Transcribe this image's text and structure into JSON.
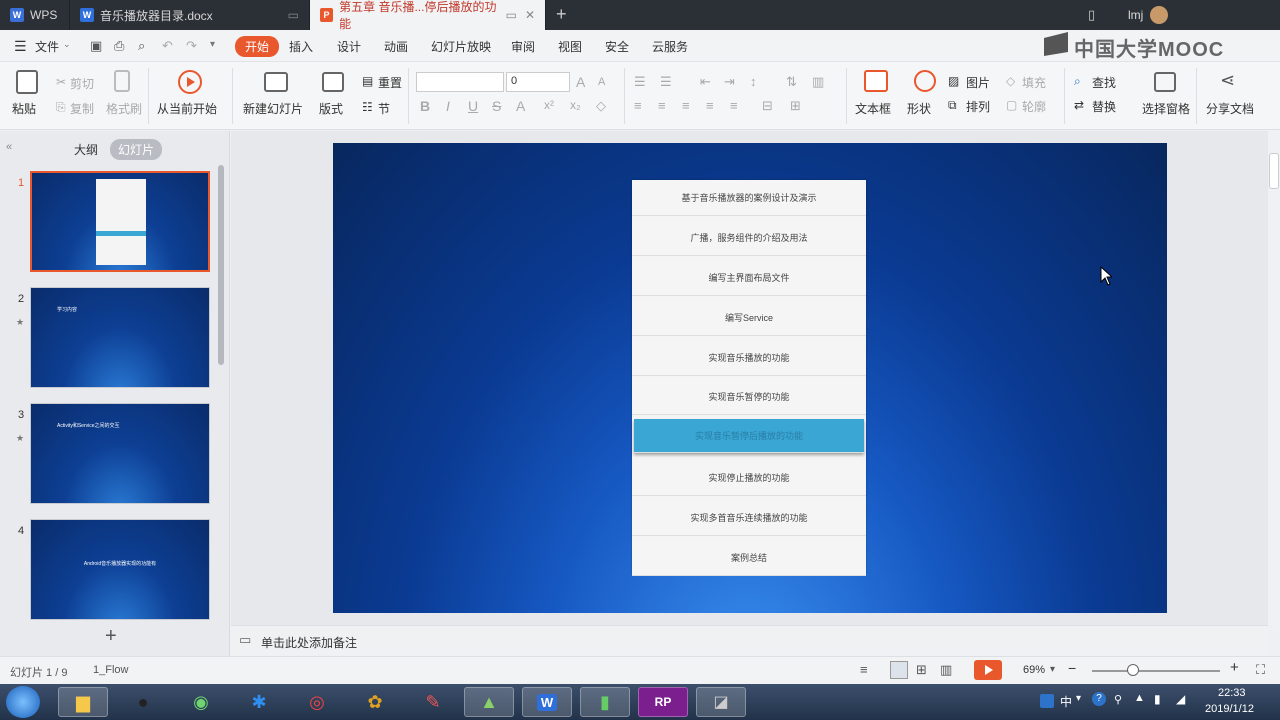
{
  "tabs": [
    {
      "label": "WPS",
      "type": "wps"
    },
    {
      "label": "音乐播放器目录.docx",
      "type": "doc"
    },
    {
      "label": "第五章 音乐播...停后播放的功能",
      "type": "ppt"
    }
  ],
  "user": "lmj",
  "watermark": "中国大学MOOC",
  "menus": [
    "文件",
    "开始",
    "插入",
    "设计",
    "动画",
    "幻灯片放映",
    "审阅",
    "视图",
    "安全",
    "云服务"
  ],
  "ribbon": {
    "paste": "粘贴",
    "cut": "剪切",
    "copy": "复制",
    "format_painter": "格式刷",
    "from_current": "从当前开始",
    "new_slide": "新建幻灯片",
    "layout": "版式",
    "reset": "重置",
    "section": "节",
    "font_size": "0",
    "textbox": "文本框",
    "shape": "形状",
    "picture": "图片",
    "fill": "填充",
    "arrange": "排列",
    "outline": "轮廓",
    "find": "查找",
    "replace": "替换",
    "select_pane": "选择窗格",
    "share": "分享文档"
  },
  "left_panel": {
    "tab_outline": "大纲",
    "tab_slides": "幻灯片",
    "slides": [
      {
        "num": "1",
        "text": ""
      },
      {
        "num": "2",
        "text": "学习内容"
      },
      {
        "num": "3",
        "text": "Activity和Service之间的交互"
      },
      {
        "num": "4",
        "text": "Android音乐播放器实现的功能有"
      }
    ],
    "add": "+"
  },
  "slide_menu": [
    "基于音乐播放器的案例设计及演示",
    "广播，服务组件的介绍及用法",
    "编写主界面布局文件",
    "编写Service",
    "实现音乐播放的功能",
    "实现音乐暂停的功能",
    "实现音乐暂停后播放的功能",
    "实现停止播放的功能",
    "实现多首音乐连续播放的功能",
    "案例总结"
  ],
  "highlight_index": 6,
  "notes_placeholder": "单击此处添加备注",
  "status": {
    "slide_info": "幻灯片 1 / 9",
    "theme": "1_Flow",
    "zoom": "69%"
  },
  "clock": {
    "time": "22:33",
    "date": "2019/1/12"
  },
  "tray": {
    "ime": "中"
  },
  "colors": {
    "accent": "#e9572d",
    "highlight": "#39a6d4",
    "slide_bg": "#0a3a92"
  }
}
